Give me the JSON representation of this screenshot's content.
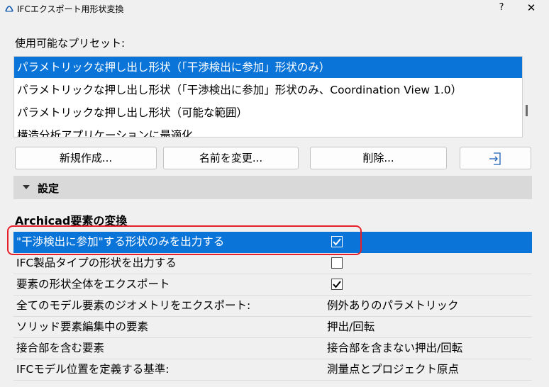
{
  "window": {
    "title": "IFCエクスポート用形状変換",
    "help_label": "?",
    "close_label": "✕"
  },
  "presets": {
    "label": "使用可能なプリセット:",
    "items": [
      "パラメトリックな押し出し形状（「干渉検出に参加」形状のみ）",
      "パラメトリックな押し出し形状（「干渉検出に参加」形状のみ、Coordination View 1.0）",
      "パラメトリックな押し出し形状（可能な範囲）",
      "構造分析アプリケーションに最適化"
    ],
    "selected_index": 0
  },
  "buttons": {
    "new_label": "新規作成...",
    "rename_label": "名前を変更...",
    "delete_label": "削除...",
    "export_icon": "export-icon"
  },
  "settings": {
    "label": "設定",
    "expanded": true
  },
  "section": {
    "heading": "Archicad要素の変換"
  },
  "rows": [
    {
      "label": "\"干渉検出に参加\"する形状のみを出力する",
      "type": "checkbox",
      "checked": true,
      "highlighted": true
    },
    {
      "label": "IFC製品タイプの形状を出力する",
      "type": "checkbox",
      "checked": false
    },
    {
      "label": "要素の形状全体をエクスポート",
      "type": "checkbox",
      "checked": true
    },
    {
      "label": "全てのモデル要素のジオメトリをエクスポート:",
      "type": "value",
      "value": "例外ありのパラメトリック"
    },
    {
      "label": "ソリッド要素編集中の要素",
      "type": "value",
      "value": "押出/回転"
    },
    {
      "label": "接合部を含む要素",
      "type": "value",
      "value": "接合部を含まない押出/回転"
    },
    {
      "label": "IFCモデル位置を定義する基準:",
      "type": "value",
      "value": "測量点とプロジェクト原点"
    }
  ],
  "colors": {
    "selection": "#0a74d8",
    "annotation": "#e5202a"
  }
}
